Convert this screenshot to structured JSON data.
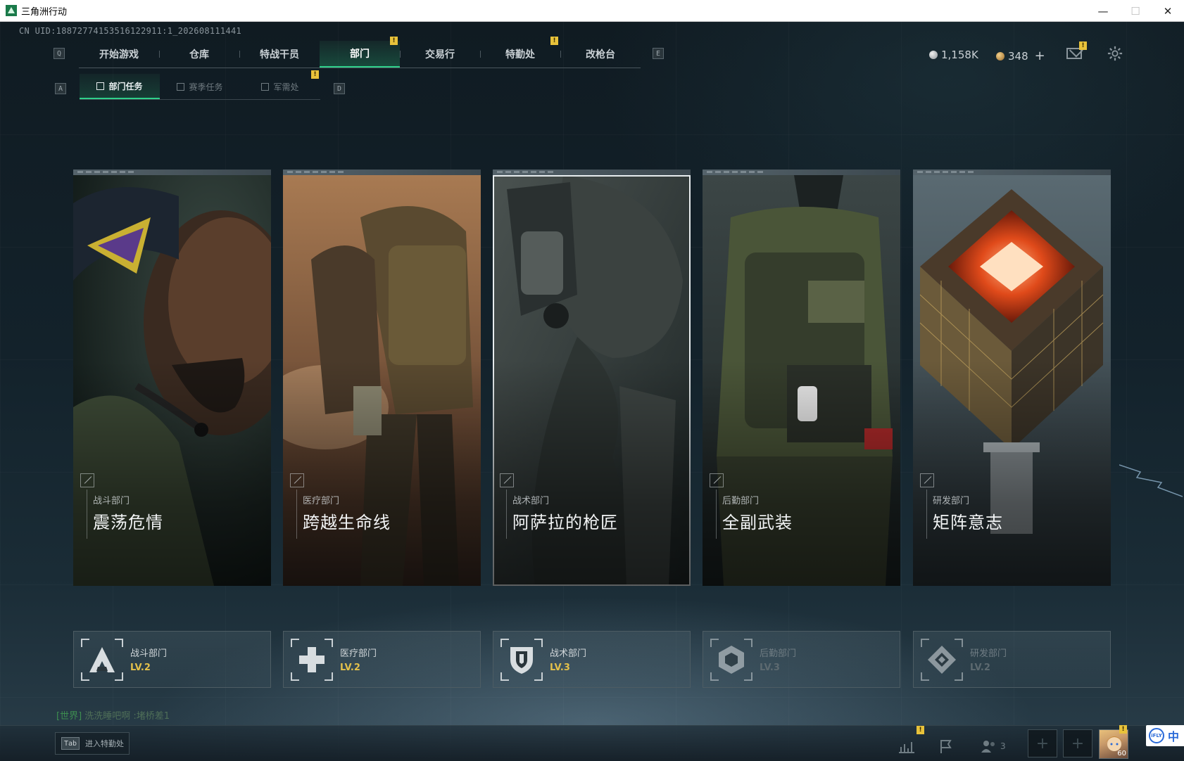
{
  "window": {
    "title": "三角洲行动",
    "controls": {
      "minimize": "—",
      "maximize": "☐",
      "close": "✕"
    }
  },
  "uid": "CN UID:18872774153516122911:1_202608111441",
  "topnav": {
    "key_left": "Q",
    "key_right": "E",
    "tabs": [
      {
        "label": "开始游戏"
      },
      {
        "label": "仓库"
      },
      {
        "label": "特战干员"
      },
      {
        "label": "部门",
        "active": true,
        "badge": "!"
      },
      {
        "label": "交易行"
      },
      {
        "label": "特勤处",
        "badge": "!"
      },
      {
        "label": "改枪台"
      }
    ]
  },
  "currency": {
    "silver": "1,158K",
    "gold": "348",
    "add": "+"
  },
  "mail_badge": "!",
  "subnav": {
    "key_left": "A",
    "key_right": "D",
    "tabs": [
      {
        "label": "部门任务",
        "active": true
      },
      {
        "label": "赛季任务"
      },
      {
        "label": "军需处",
        "badge": "!"
      }
    ]
  },
  "departments": [
    {
      "dept": "战斗部门",
      "mission": "震荡危情",
      "level": "LV.2",
      "emblem": "combat-emblem-icon"
    },
    {
      "dept": "医疗部门",
      "mission": "跨越生命线",
      "level": "LV.2",
      "emblem": "medical-emblem-icon"
    },
    {
      "dept": "战术部门",
      "mission": "阿萨拉的枪匠",
      "level": "LV.3",
      "emblem": "tactical-emblem-icon"
    },
    {
      "dept": "后勤部门",
      "mission": "全副武装",
      "level": "LV.3",
      "emblem": "logistics-emblem-icon"
    },
    {
      "dept": "研发部门",
      "mission": "矩阵意志",
      "level": "LV.2",
      "emblem": "rnd-emblem-icon"
    }
  ],
  "chat": {
    "channel": "[世界]",
    "text": "洗洗睡吧啊 :堵桥差1"
  },
  "bottom": {
    "tab_key": "Tab",
    "tab_label": "进入特勤处",
    "stats_badge": "!",
    "squad_count": "3",
    "avatar_level": "60",
    "avatar_badge": "!"
  },
  "ime": {
    "icon_text": "iFLY",
    "lang": "中"
  },
  "colors": {
    "accent_green": "#2fd08a",
    "badge_yellow": "#e8c23a",
    "level_gold": "#e3c04a"
  }
}
